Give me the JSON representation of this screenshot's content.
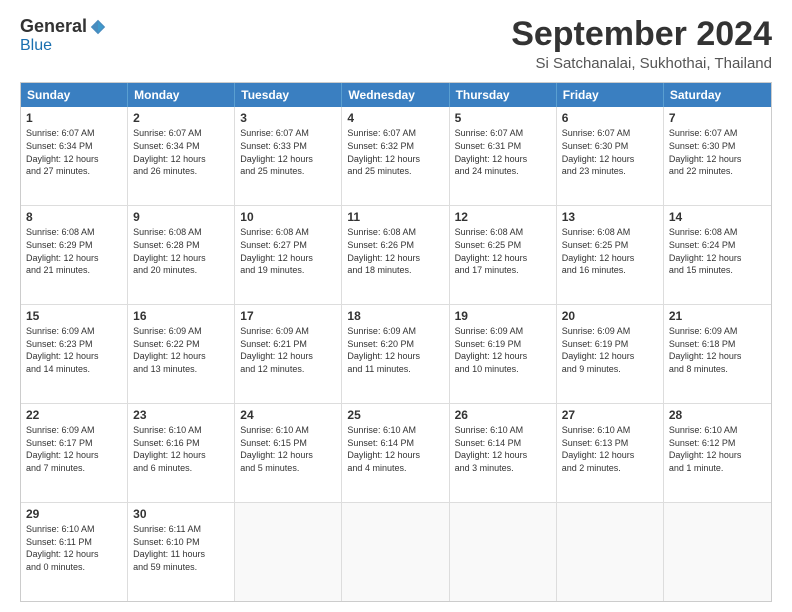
{
  "header": {
    "logo_general": "General",
    "logo_blue": "Blue",
    "month_title": "September 2024",
    "location": "Si Satchanalai, Sukhothai, Thailand"
  },
  "weekdays": [
    "Sunday",
    "Monday",
    "Tuesday",
    "Wednesday",
    "Thursday",
    "Friday",
    "Saturday"
  ],
  "weeks": [
    [
      {
        "day": "1",
        "info": "Sunrise: 6:07 AM\nSunset: 6:34 PM\nDaylight: 12 hours\nand 27 minutes."
      },
      {
        "day": "2",
        "info": "Sunrise: 6:07 AM\nSunset: 6:34 PM\nDaylight: 12 hours\nand 26 minutes."
      },
      {
        "day": "3",
        "info": "Sunrise: 6:07 AM\nSunset: 6:33 PM\nDaylight: 12 hours\nand 25 minutes."
      },
      {
        "day": "4",
        "info": "Sunrise: 6:07 AM\nSunset: 6:32 PM\nDaylight: 12 hours\nand 25 minutes."
      },
      {
        "day": "5",
        "info": "Sunrise: 6:07 AM\nSunset: 6:31 PM\nDaylight: 12 hours\nand 24 minutes."
      },
      {
        "day": "6",
        "info": "Sunrise: 6:07 AM\nSunset: 6:30 PM\nDaylight: 12 hours\nand 23 minutes."
      },
      {
        "day": "7",
        "info": "Sunrise: 6:07 AM\nSunset: 6:30 PM\nDaylight: 12 hours\nand 22 minutes."
      }
    ],
    [
      {
        "day": "8",
        "info": "Sunrise: 6:08 AM\nSunset: 6:29 PM\nDaylight: 12 hours\nand 21 minutes."
      },
      {
        "day": "9",
        "info": "Sunrise: 6:08 AM\nSunset: 6:28 PM\nDaylight: 12 hours\nand 20 minutes."
      },
      {
        "day": "10",
        "info": "Sunrise: 6:08 AM\nSunset: 6:27 PM\nDaylight: 12 hours\nand 19 minutes."
      },
      {
        "day": "11",
        "info": "Sunrise: 6:08 AM\nSunset: 6:26 PM\nDaylight: 12 hours\nand 18 minutes."
      },
      {
        "day": "12",
        "info": "Sunrise: 6:08 AM\nSunset: 6:25 PM\nDaylight: 12 hours\nand 17 minutes."
      },
      {
        "day": "13",
        "info": "Sunrise: 6:08 AM\nSunset: 6:25 PM\nDaylight: 12 hours\nand 16 minutes."
      },
      {
        "day": "14",
        "info": "Sunrise: 6:08 AM\nSunset: 6:24 PM\nDaylight: 12 hours\nand 15 minutes."
      }
    ],
    [
      {
        "day": "15",
        "info": "Sunrise: 6:09 AM\nSunset: 6:23 PM\nDaylight: 12 hours\nand 14 minutes."
      },
      {
        "day": "16",
        "info": "Sunrise: 6:09 AM\nSunset: 6:22 PM\nDaylight: 12 hours\nand 13 minutes."
      },
      {
        "day": "17",
        "info": "Sunrise: 6:09 AM\nSunset: 6:21 PM\nDaylight: 12 hours\nand 12 minutes."
      },
      {
        "day": "18",
        "info": "Sunrise: 6:09 AM\nSunset: 6:20 PM\nDaylight: 12 hours\nand 11 minutes."
      },
      {
        "day": "19",
        "info": "Sunrise: 6:09 AM\nSunset: 6:19 PM\nDaylight: 12 hours\nand 10 minutes."
      },
      {
        "day": "20",
        "info": "Sunrise: 6:09 AM\nSunset: 6:19 PM\nDaylight: 12 hours\nand 9 minutes."
      },
      {
        "day": "21",
        "info": "Sunrise: 6:09 AM\nSunset: 6:18 PM\nDaylight: 12 hours\nand 8 minutes."
      }
    ],
    [
      {
        "day": "22",
        "info": "Sunrise: 6:09 AM\nSunset: 6:17 PM\nDaylight: 12 hours\nand 7 minutes."
      },
      {
        "day": "23",
        "info": "Sunrise: 6:10 AM\nSunset: 6:16 PM\nDaylight: 12 hours\nand 6 minutes."
      },
      {
        "day": "24",
        "info": "Sunrise: 6:10 AM\nSunset: 6:15 PM\nDaylight: 12 hours\nand 5 minutes."
      },
      {
        "day": "25",
        "info": "Sunrise: 6:10 AM\nSunset: 6:14 PM\nDaylight: 12 hours\nand 4 minutes."
      },
      {
        "day": "26",
        "info": "Sunrise: 6:10 AM\nSunset: 6:14 PM\nDaylight: 12 hours\nand 3 minutes."
      },
      {
        "day": "27",
        "info": "Sunrise: 6:10 AM\nSunset: 6:13 PM\nDaylight: 12 hours\nand 2 minutes."
      },
      {
        "day": "28",
        "info": "Sunrise: 6:10 AM\nSunset: 6:12 PM\nDaylight: 12 hours\nand 1 minute."
      }
    ],
    [
      {
        "day": "29",
        "info": "Sunrise: 6:10 AM\nSunset: 6:11 PM\nDaylight: 12 hours\nand 0 minutes."
      },
      {
        "day": "30",
        "info": "Sunrise: 6:11 AM\nSunset: 6:10 PM\nDaylight: 11 hours\nand 59 minutes."
      },
      {
        "day": "",
        "info": ""
      },
      {
        "day": "",
        "info": ""
      },
      {
        "day": "",
        "info": ""
      },
      {
        "day": "",
        "info": ""
      },
      {
        "day": "",
        "info": ""
      }
    ]
  ]
}
